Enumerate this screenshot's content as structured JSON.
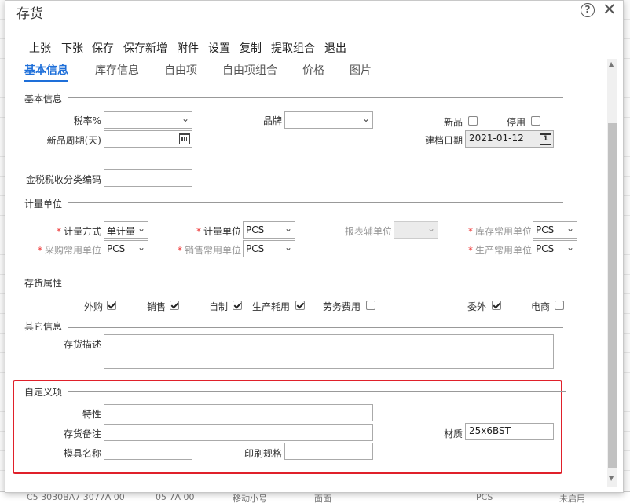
{
  "background_rows": [
    "C5 3030BA7 3077A 00",
    "05 7A 00",
    "移动小号",
    "面面",
    "PCS",
    "未启用"
  ],
  "dialog": {
    "title": "存货",
    "help_icon": "question-circle-icon",
    "close_icon": "close-x-icon"
  },
  "toolbar": [
    "上张",
    "下张",
    "保存",
    "保存新增",
    "附件",
    "设置",
    "复制",
    "提取组合",
    "退出"
  ],
  "tabs": [
    {
      "label": "基本信息",
      "active": true
    },
    {
      "label": "库存信息",
      "active": false
    },
    {
      "label": "自由项",
      "active": false
    },
    {
      "label": "自由项组合",
      "active": false
    },
    {
      "label": "价格",
      "active": false
    },
    {
      "label": "图片",
      "active": false
    }
  ],
  "basic": {
    "section": "基本信息",
    "tax_rate_label": "税率%",
    "tax_rate_value": "",
    "brand_label": "品牌",
    "brand_value": "",
    "new_label": "新品",
    "new_checked": false,
    "disabled_label": "停用",
    "disabled_checked": false,
    "new_period_label": "新品周期(天)",
    "new_period_value": "",
    "created_date_label": "建档日期",
    "created_date_value": "2021-01-12",
    "tax_code_label": "金税税收分类编码",
    "tax_code_value": ""
  },
  "unit": {
    "section": "计量单位",
    "method_label": "计量方式",
    "method_value": "单计量",
    "unit_label": "计量单位",
    "unit_value": "PCS",
    "report_unit_label": "报表辅单位",
    "report_unit_value": "",
    "stock_unit_label": "库存常用单位",
    "stock_unit_value": "PCS",
    "purchase_unit_label": "采购常用单位",
    "purchase_unit_value": "PCS",
    "sales_unit_label": "销售常用单位",
    "sales_unit_value": "PCS",
    "production_unit_label": "生产常用单位",
    "production_unit_value": "PCS"
  },
  "attrs": {
    "section": "存货属性",
    "items": [
      {
        "label": "外购",
        "checked": true
      },
      {
        "label": "销售",
        "checked": true
      },
      {
        "label": "自制",
        "checked": true
      },
      {
        "label": "生产耗用",
        "checked": true
      },
      {
        "label": "劳务费用",
        "checked": false
      },
      {
        "label": "委外",
        "checked": true
      },
      {
        "label": "电商",
        "checked": false
      }
    ]
  },
  "other": {
    "section": "其它信息",
    "desc_label": "存货描述",
    "desc_value": ""
  },
  "custom": {
    "section": "自定义项",
    "feature_label": "特性",
    "feature_value": "",
    "remark_label": "存货备注",
    "remark_value": "",
    "material_label": "材质",
    "material_value": "25x6BST",
    "mold_label": "模具名称",
    "mold_value": "",
    "print_label": "印刷规格",
    "print_value": ""
  },
  "colors": {
    "accent": "#1e6fd9",
    "highlight": "#e0202a",
    "required": "#e33333"
  }
}
